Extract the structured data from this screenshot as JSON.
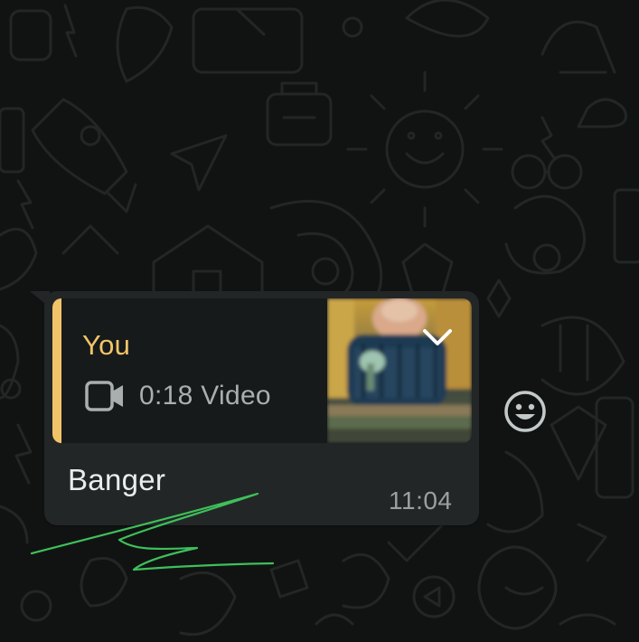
{
  "message": {
    "text": "Banger",
    "time": "11:04",
    "reply": {
      "author": "You",
      "detail": "0:18 Video",
      "media_icon": "video-camera-icon",
      "thumbnail": "video-thumbnail"
    }
  },
  "icons": {
    "menu": "chevron-down-icon",
    "reaction": "smiley-icon"
  },
  "colors": {
    "background": "#111313",
    "bubble": "#232626",
    "quote_bg": "#171a1a",
    "accent": "#f2c469",
    "text": "#e9eded",
    "muted": "#9aa0a0",
    "annotation": "#3ec05a"
  }
}
